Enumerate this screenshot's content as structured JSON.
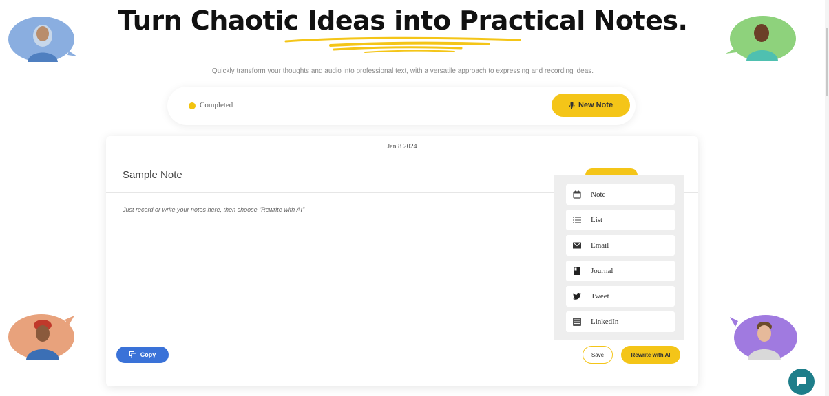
{
  "hero": {
    "title": "Turn Chaotic Ideas into Practical Notes.",
    "subtitle": "Quickly transform your thoughts and audio into professional text, with a versatile approach to expressing and recording ideas."
  },
  "status_bar": {
    "status_text": "Completed",
    "new_note_label": "New Note"
  },
  "note": {
    "date": "Jan 8 2024",
    "title": "Sample Note",
    "body": "Just record or write your notes here, then choose \"Rewrite with AI\"",
    "copy_label": "Copy",
    "save_label": "Save",
    "rewrite_label": "Rewrite with AI"
  },
  "rewrite_menu": {
    "items": [
      {
        "label": "Note",
        "icon": "calendar-icon"
      },
      {
        "label": "List",
        "icon": "list-icon"
      },
      {
        "label": "Email",
        "icon": "envelope-icon"
      },
      {
        "label": "Journal",
        "icon": "journal-icon"
      },
      {
        "label": "Tweet",
        "icon": "twitter-icon"
      },
      {
        "label": "LinkedIn",
        "icon": "linkedin-icon"
      }
    ]
  },
  "colors": {
    "accent_yellow": "#f4c518",
    "copy_blue": "#3a72d8",
    "chat_teal": "#1e7e8a",
    "avatar_blue": "#8aaee0",
    "avatar_green": "#8ed27c",
    "avatar_orange": "#e8a27c",
    "avatar_purple": "#a07ae0"
  }
}
